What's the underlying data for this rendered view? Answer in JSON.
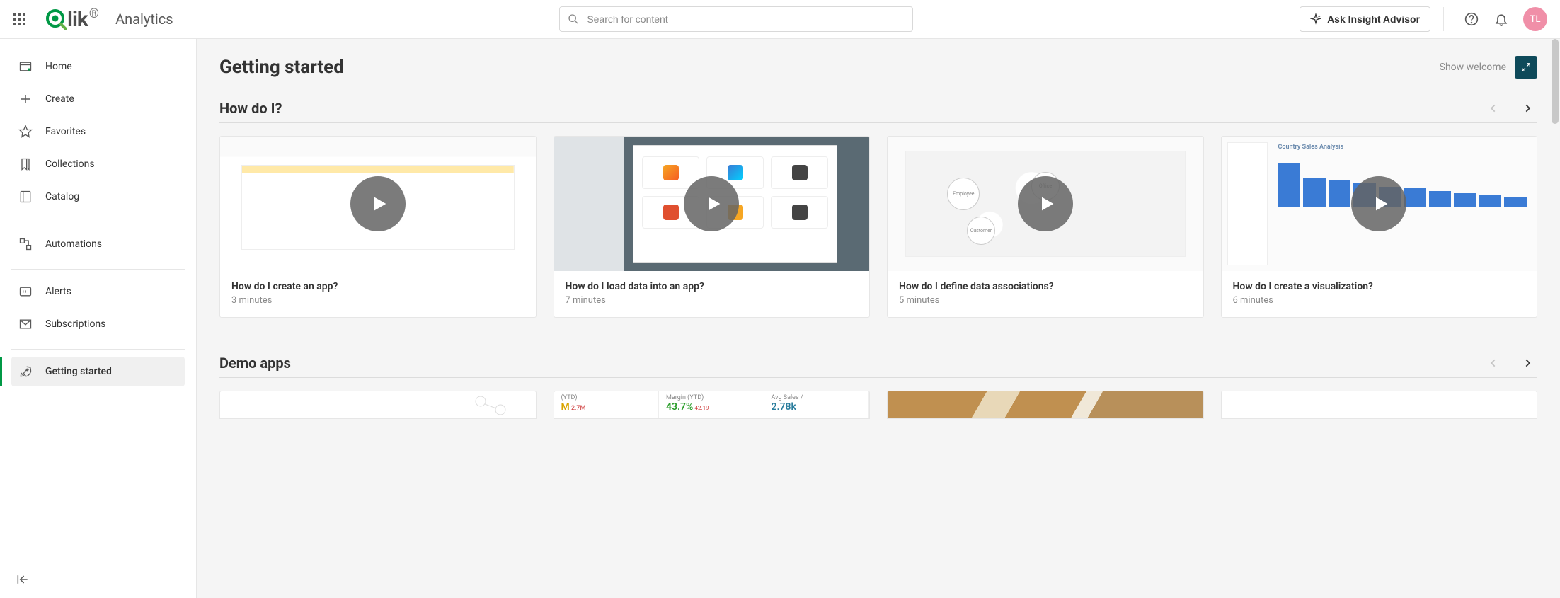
{
  "brand": {
    "product": "Analytics"
  },
  "topbar": {
    "search_placeholder": "Search for content",
    "insight_button": "Ask Insight Advisor",
    "avatar_initials": "TL"
  },
  "sidebar": {
    "items": [
      {
        "id": "home",
        "label": "Home"
      },
      {
        "id": "create",
        "label": "Create"
      },
      {
        "id": "favorites",
        "label": "Favorites"
      },
      {
        "id": "collections",
        "label": "Collections"
      },
      {
        "id": "catalog",
        "label": "Catalog"
      },
      {
        "id": "automations",
        "label": "Automations"
      },
      {
        "id": "alerts",
        "label": "Alerts"
      },
      {
        "id": "subscriptions",
        "label": "Subscriptions"
      },
      {
        "id": "getting-started",
        "label": "Getting started"
      }
    ],
    "active": "getting-started"
  },
  "main": {
    "page_title": "Getting started",
    "show_welcome_label": "Show welcome",
    "sections": {
      "howdoi": {
        "title": "How do I?",
        "cards": [
          {
            "title": "How do I create an app?",
            "sub": "3 minutes"
          },
          {
            "title": "How do I load data into an app?",
            "sub": "7 minutes"
          },
          {
            "title": "How do I define data associations?",
            "sub": "5 minutes"
          },
          {
            "title": "How do I create a visualization?",
            "sub": "6 minutes"
          }
        ],
        "card4_panel_title": "Country Sales Analysis"
      },
      "demoapps": {
        "title": "Demo apps",
        "kpi": {
          "ytd_label": "(YTD)",
          "ytd_value_prefix": "M",
          "ytd_value_suffix": "2.7M",
          "margin_label": "Margin (YTD)",
          "margin_value": "43.7%",
          "margin_delta": "42.19",
          "avg_label": "Avg Sales /",
          "avg_value": "2.78k"
        }
      }
    }
  }
}
